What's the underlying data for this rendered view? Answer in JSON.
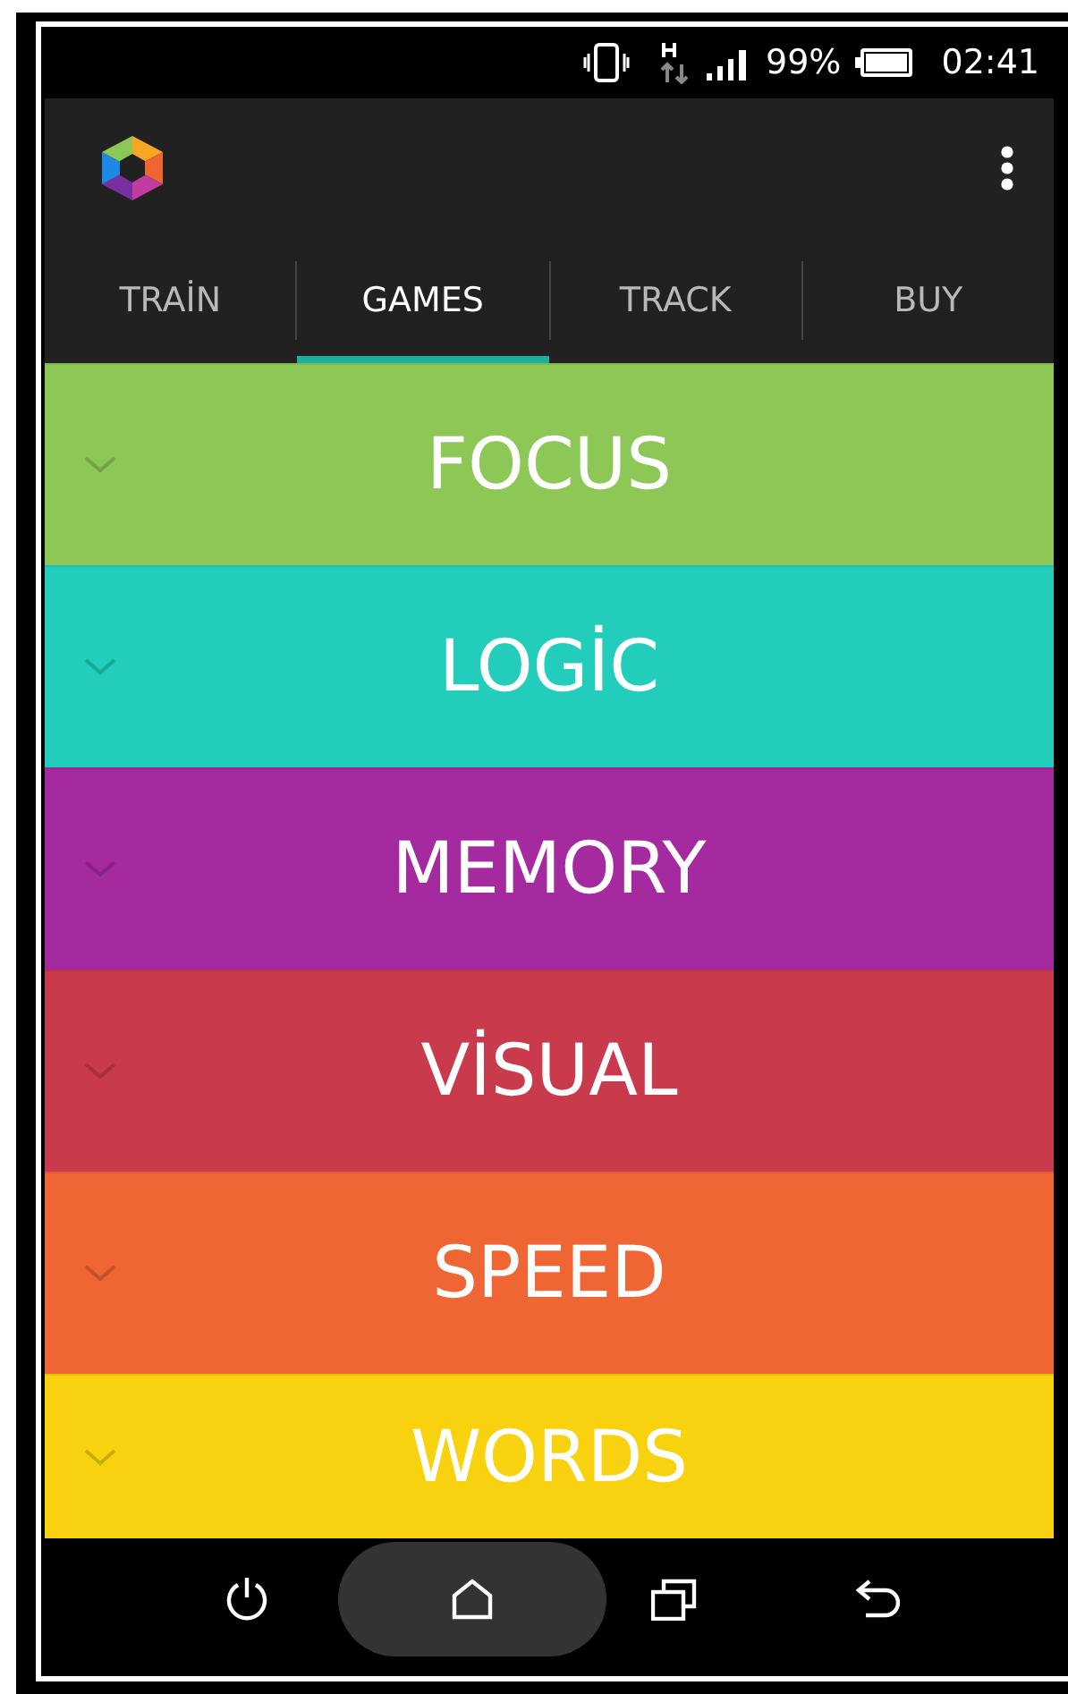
{
  "status_bar": {
    "battery": "99%",
    "time": "02:41"
  },
  "tabs": [
    {
      "label": "TRAİN",
      "selected": false
    },
    {
      "label": "GAMES",
      "selected": true
    },
    {
      "label": "TRACK",
      "selected": false
    },
    {
      "label": "BUY",
      "selected": false
    }
  ],
  "categories": [
    {
      "label": "FOCUS",
      "color": "#8dc756"
    },
    {
      "label": "LOGİC",
      "color": "#22cdbb"
    },
    {
      "label": "MEMORY",
      "color": "#a62a9f"
    },
    {
      "label": "VİSUAL",
      "color": "#c93a4c"
    },
    {
      "label": "SPEED",
      "color": "#ef6533"
    },
    {
      "label": "WORDS",
      "color": "#f9d20f"
    }
  ]
}
